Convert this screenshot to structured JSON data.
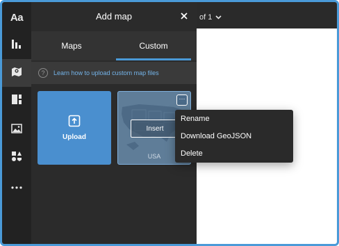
{
  "panel": {
    "title": "Add map",
    "close_icon": "close-icon"
  },
  "tabs": [
    {
      "label": "Maps",
      "active": false
    },
    {
      "label": "Custom",
      "active": true
    }
  ],
  "help": {
    "icon": "question-icon",
    "text": "Learn how to upload custom map files"
  },
  "upload": {
    "label": "Upload",
    "icon": "upload-icon"
  },
  "map_card": {
    "insert_label": "Insert",
    "name": "USA",
    "more_icon": "more-icon"
  },
  "context_menu": {
    "items": [
      "Rename",
      "Download GeoJSON",
      "Delete"
    ]
  },
  "page_indicator": {
    "text": "of 1",
    "icon": "chevron-down-icon"
  },
  "sidebar": {
    "items": [
      {
        "label": "Aa",
        "icon": "text-icon"
      },
      {
        "icon": "chart-icon"
      },
      {
        "icon": "map-icon",
        "active": true
      },
      {
        "icon": "layout-icon"
      },
      {
        "icon": "image-icon"
      },
      {
        "icon": "shapes-icon"
      },
      {
        "icon": "more-icon"
      }
    ]
  },
  "colors": {
    "accent": "#4a9ad8",
    "panel_bg": "#2b2b2b",
    "rail_bg": "#222222"
  }
}
